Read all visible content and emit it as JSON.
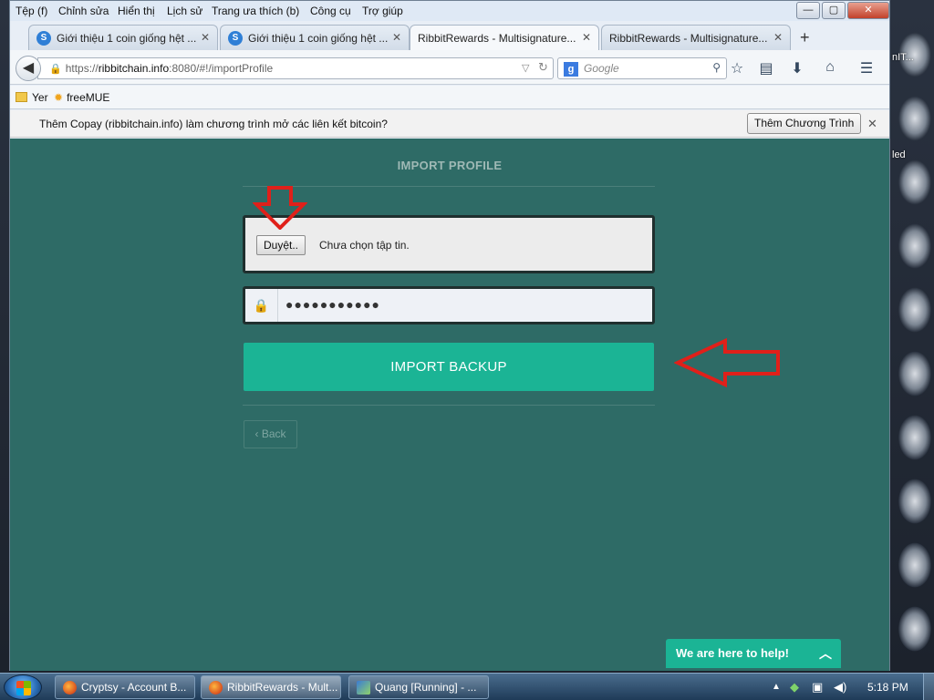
{
  "menu": [
    "Tệp (f)",
    "Chỉnh sửa",
    "Hiển thị",
    "Lịch sử",
    "Trang ưa thích (b)",
    "Công cụ",
    "Trợ giúp"
  ],
  "window_controls": {
    "minimize": "—",
    "maximize": "▢",
    "close": "✕"
  },
  "tabs": [
    {
      "title": "Giới thiệu 1 coin giống hệt ...",
      "icon": "skype-favicon-icon"
    },
    {
      "title": "Giới thiệu 1 coin giống hệt ...",
      "icon": "skype-favicon-icon"
    },
    {
      "title": "RibbitRewards - Multisignature...",
      "icon": "none"
    },
    {
      "title": "RibbitRewards - Multisignature...",
      "icon": "none"
    }
  ],
  "url": {
    "scheme": "https://",
    "host": "ribbitchain.info",
    "rest": ":8080/#!/importProfile"
  },
  "search": {
    "placeholder": "Google"
  },
  "bookmarks": [
    "Yer",
    "freeMUE"
  ],
  "notification": {
    "text": "Thêm Copay (ribbitchain.info) làm chương trình mở các liên kết bitcoin?",
    "button": "Thêm Chương Trình"
  },
  "page": {
    "title": "IMPORT PROFILE",
    "file_button": "Duyệt..",
    "file_status": "Chưa chọn tập tin.",
    "password_value": "●●●●●●●●●●●",
    "import_button": "IMPORT BACKUP",
    "back_label": "Back",
    "help_widget": "We are here to help!"
  },
  "desktop_labels": [
    "nIT...",
    "led"
  ],
  "taskbar": {
    "items": [
      {
        "label": "Cryptsy - Account B..."
      },
      {
        "label": "RibbitRewards - Mult..."
      },
      {
        "label": "Quang [Running] - ..."
      }
    ],
    "clock": "5:18 PM"
  },
  "colors": {
    "page_background": "#2e6b66",
    "accent_button": "#1bb495",
    "annotation_arrow": "#e0201a"
  }
}
